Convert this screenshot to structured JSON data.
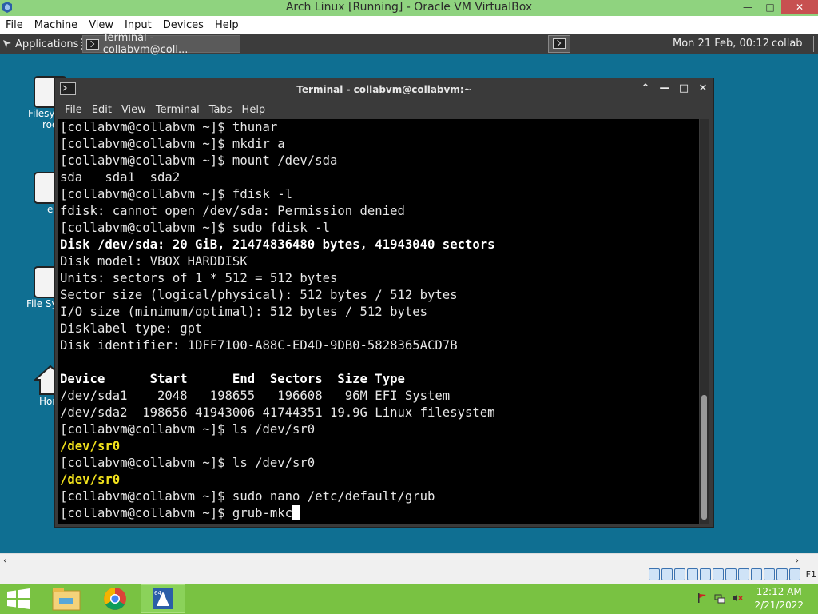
{
  "host_window": {
    "title": "Arch Linux [Running] - Oracle VM VirtualBox",
    "menu": [
      "File",
      "Machine",
      "View",
      "Input",
      "Devices",
      "Help"
    ],
    "controls": {
      "minimize": "—",
      "restore": "□",
      "close": "✕"
    }
  },
  "guest_panel": {
    "applications_label": "Applications",
    "task_label": "Terminal - collabvm@coll...",
    "clock": "Mon 21 Feb, 00:12",
    "user": "collab"
  },
  "desktop_icons": [
    {
      "label": "Filesy",
      "label2": "roo"
    },
    {
      "label": "e",
      "label2": ""
    },
    {
      "label": "File Sy",
      "label2": ""
    },
    {
      "label": "Hon",
      "label2": ""
    }
  ],
  "terminal": {
    "title": "Terminal - collabvm@collabvm:~",
    "menu": [
      "File",
      "Edit",
      "View",
      "Terminal",
      "Tabs",
      "Help"
    ],
    "controls": {
      "up": "⌃",
      "minimize": "—",
      "maximize": "□",
      "close": "✕"
    },
    "lines": [
      {
        "text": "[collabvm@collabvm ~]$ thunar",
        "style": "normal"
      },
      {
        "text": "[collabvm@collabvm ~]$ mkdir a",
        "style": "normal"
      },
      {
        "text": "[collabvm@collabvm ~]$ mount /dev/sda",
        "style": "normal"
      },
      {
        "text": "sda   sda1  sda2",
        "style": "normal"
      },
      {
        "text": "[collabvm@collabvm ~]$ fdisk -l",
        "style": "normal"
      },
      {
        "text": "fdisk: cannot open /dev/sda: Permission denied",
        "style": "normal"
      },
      {
        "text": "[collabvm@collabvm ~]$ sudo fdisk -l",
        "style": "normal"
      },
      {
        "text": "Disk /dev/sda: 20 GiB, 21474836480 bytes, 41943040 sectors",
        "style": "bold"
      },
      {
        "text": "Disk model: VBOX HARDDISK",
        "style": "normal"
      },
      {
        "text": "Units: sectors of 1 * 512 = 512 bytes",
        "style": "normal"
      },
      {
        "text": "Sector size (logical/physical): 512 bytes / 512 bytes",
        "style": "normal"
      },
      {
        "text": "I/O size (minimum/optimal): 512 bytes / 512 bytes",
        "style": "normal"
      },
      {
        "text": "Disklabel type: gpt",
        "style": "normal"
      },
      {
        "text": "Disk identifier: 1DFF7100-A88C-ED4D-9DB0-5828365ACD7B",
        "style": "normal"
      },
      {
        "text": "",
        "style": "normal"
      },
      {
        "text": "Device      Start      End  Sectors  Size Type",
        "style": "bold"
      },
      {
        "text": "/dev/sda1    2048   198655   196608   96M EFI System",
        "style": "normal"
      },
      {
        "text": "/dev/sda2  198656 41943006 41744351 19.9G Linux filesystem",
        "style": "normal"
      },
      {
        "text": "[collabvm@collabvm ~]$ ls /dev/sr0",
        "style": "normal"
      },
      {
        "text": "/dev/sr0",
        "style": "yellow"
      },
      {
        "text": "[collabvm@collabvm ~]$ ls /dev/sr0",
        "style": "normal"
      },
      {
        "text": "/dev/sr0",
        "style": "yellow"
      },
      {
        "text": "[collabvm@collabvm ~]$ sudo nano /etc/default/grub",
        "style": "normal"
      },
      {
        "text": "[collabvm@collabvm ~]$ grub-mkc",
        "style": "normal"
      }
    ]
  },
  "host_scroll": {
    "left": "‹",
    "right": "›"
  },
  "vb_status": {
    "host_key": "F1"
  },
  "taskbar": {
    "time": "12:12 AM",
    "date": "2/21/2022"
  }
}
